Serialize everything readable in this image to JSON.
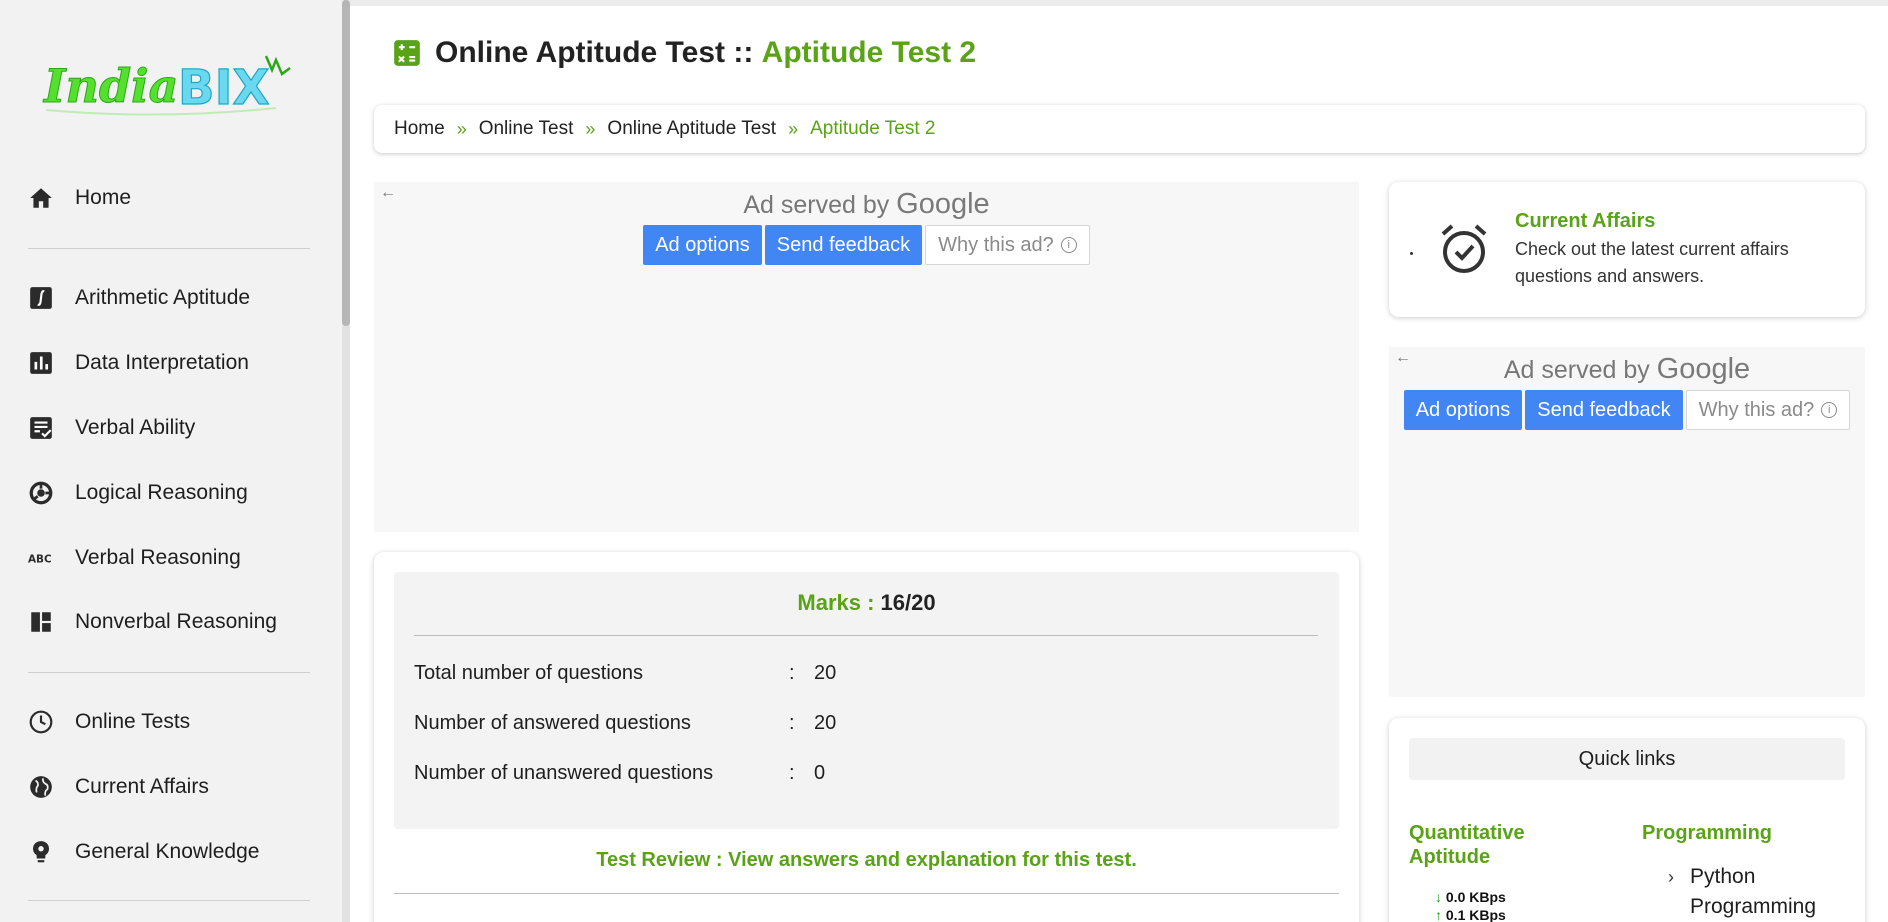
{
  "sidebar": {
    "logo_text": "IndiaBIX",
    "group1": [
      {
        "label": "Home",
        "icon": "home-icon"
      }
    ],
    "group2": [
      {
        "label": "Arithmetic Aptitude",
        "icon": "integral-icon"
      },
      {
        "label": "Data Interpretation",
        "icon": "bar-chart-icon"
      },
      {
        "label": "Verbal Ability",
        "icon": "spellcheck-icon"
      },
      {
        "label": "Logical Reasoning",
        "icon": "logical-icon"
      },
      {
        "label": "Verbal Reasoning",
        "icon": "abc-icon"
      },
      {
        "label": "Nonverbal Reasoning",
        "icon": "dashboard-icon"
      }
    ],
    "group3": [
      {
        "label": "Online Tests",
        "icon": "clock-icon"
      },
      {
        "label": "Current Affairs",
        "icon": "globe-icon"
      },
      {
        "label": "General Knowledge",
        "icon": "bulb-icon"
      }
    ]
  },
  "header": {
    "title_prefix": "Online Aptitude Test :: ",
    "title_highlight": "Aptitude Test 2"
  },
  "breadcrumb": [
    {
      "label": "Home"
    },
    {
      "label": "Online Test"
    },
    {
      "label": "Online Aptitude Test"
    },
    {
      "label": "Aptitude Test 2",
      "active": true
    }
  ],
  "breadcrumb_separator": "»",
  "ads": {
    "back_arrow": "←",
    "served_by": "Ad served by ",
    "google": "Google",
    "ad_options": "Ad options",
    "send_feedback": "Send feedback",
    "why_this_ad": "Why this ad?",
    "info_glyph": "i"
  },
  "result": {
    "marks_label": "Marks : ",
    "marks_value": "16/20",
    "rows": [
      {
        "label": "Total number of questions",
        "sep": ":",
        "value": "20"
      },
      {
        "label": "Number of answered questions",
        "sep": ":",
        "value": "20"
      },
      {
        "label": "Number of unanswered questions",
        "sep": ":",
        "value": "0"
      }
    ],
    "review_link": "Test Review : View answers and explanation for this test."
  },
  "current_affairs": {
    "title": "Current Affairs",
    "description": "Check out the latest current affairs questions and answers.",
    "icon": "alarm-check-icon"
  },
  "quick_links": {
    "heading": "Quick links",
    "col1_title": "Quantitative Aptitude",
    "col2_title": "Programming",
    "col2_items": [
      "Python Programming"
    ],
    "chevron": "›"
  },
  "network_speed": {
    "download": "0.0 KBps",
    "upload": "0.1 KBps"
  },
  "colors": {
    "accent_green": "#5aa317",
    "ad_blue": "#4285f4"
  }
}
